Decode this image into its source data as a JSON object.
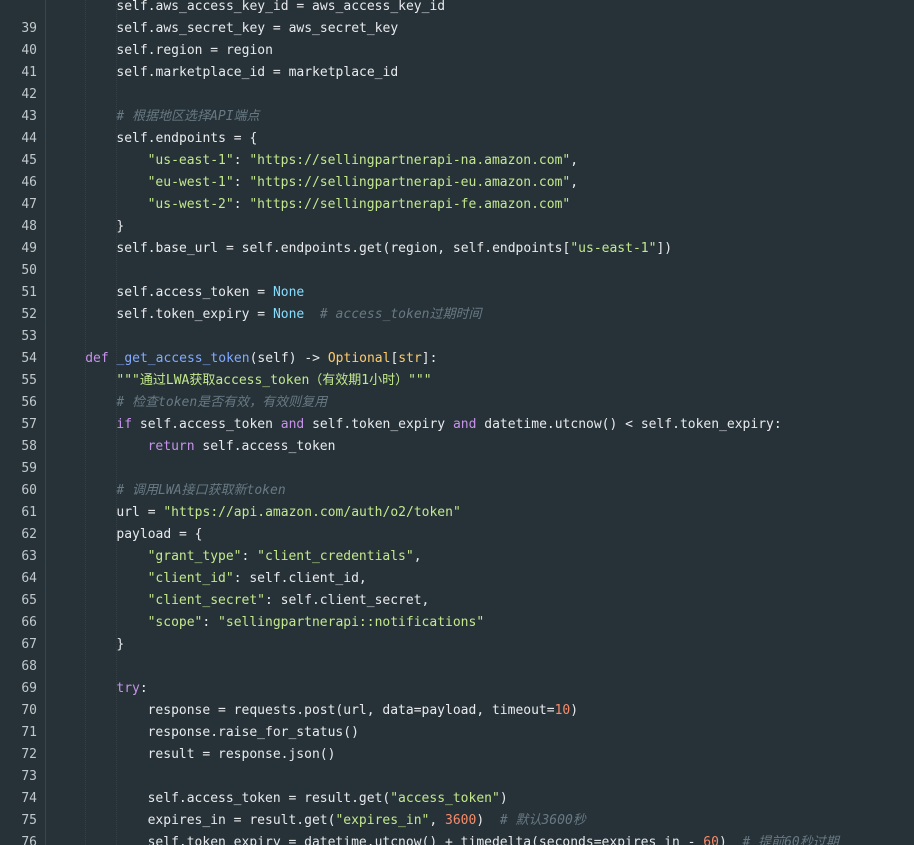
{
  "editor": {
    "language": "python",
    "colors": {
      "background": "#263238",
      "gutter_text": "#c0c8cc",
      "plain": "#e8eaed",
      "keyword": "#c792ea",
      "function": "#82aaff",
      "string": "#c3e88d",
      "comment": "#697982",
      "number": "#f78c6c",
      "constant": "#89ddff",
      "type": "#ffcb6b"
    },
    "lines": [
      {
        "n": "",
        "indent": 8,
        "tokens": [
          [
            "pl",
            "self.aws_access_key_id = aws_access_key_id"
          ]
        ]
      },
      {
        "n": "39",
        "indent": 8,
        "tokens": [
          [
            "pl",
            "self.aws_secret_key = aws_secret_key"
          ]
        ]
      },
      {
        "n": "40",
        "indent": 8,
        "tokens": [
          [
            "pl",
            "self.region = region"
          ]
        ]
      },
      {
        "n": "41",
        "indent": 8,
        "tokens": [
          [
            "pl",
            "self.marketplace_id = marketplace_id"
          ]
        ]
      },
      {
        "n": "42",
        "indent": 0,
        "tokens": []
      },
      {
        "n": "43",
        "indent": 8,
        "tokens": [
          [
            "cm",
            "# 根据地区选择API端点"
          ]
        ]
      },
      {
        "n": "44",
        "indent": 8,
        "tokens": [
          [
            "pl",
            "self.endpoints = {"
          ]
        ]
      },
      {
        "n": "45",
        "indent": 12,
        "tokens": [
          [
            "st",
            "\"us-east-1\""
          ],
          [
            "pl",
            ": "
          ],
          [
            "st",
            "\"https://sellingpartnerapi-na.amazon.com\""
          ],
          [
            "pl",
            ","
          ]
        ]
      },
      {
        "n": "46",
        "indent": 12,
        "tokens": [
          [
            "st",
            "\"eu-west-1\""
          ],
          [
            "pl",
            ": "
          ],
          [
            "st",
            "\"https://sellingpartnerapi-eu.amazon.com\""
          ],
          [
            "pl",
            ","
          ]
        ]
      },
      {
        "n": "47",
        "indent": 12,
        "tokens": [
          [
            "st",
            "\"us-west-2\""
          ],
          [
            "pl",
            ": "
          ],
          [
            "st",
            "\"https://sellingpartnerapi-fe.amazon.com\""
          ]
        ]
      },
      {
        "n": "48",
        "indent": 8,
        "tokens": [
          [
            "pl",
            "}"
          ]
        ]
      },
      {
        "n": "49",
        "indent": 8,
        "tokens": [
          [
            "pl",
            "self.base_url = self.endpoints.get(region, self.endpoints["
          ],
          [
            "st",
            "\"us-east-1\""
          ],
          [
            "pl",
            "])"
          ]
        ]
      },
      {
        "n": "50",
        "indent": 0,
        "tokens": []
      },
      {
        "n": "51",
        "indent": 8,
        "tokens": [
          [
            "pl",
            "self.access_token = "
          ],
          [
            "cn",
            "None"
          ]
        ]
      },
      {
        "n": "52",
        "indent": 8,
        "tokens": [
          [
            "pl",
            "self.token_expiry = "
          ],
          [
            "cn",
            "None"
          ],
          [
            "pl",
            "  "
          ],
          [
            "cm",
            "# access_token过期时间"
          ]
        ]
      },
      {
        "n": "53",
        "indent": 0,
        "tokens": []
      },
      {
        "n": "54",
        "indent": 4,
        "tokens": [
          [
            "kw",
            "def "
          ],
          [
            "fn",
            "_get_access_token"
          ],
          [
            "pl",
            "(self) -> "
          ],
          [
            "ty",
            "Optional"
          ],
          [
            "pl",
            "["
          ],
          [
            "ty",
            "str"
          ],
          [
            "pl",
            "]:"
          ]
        ]
      },
      {
        "n": "55",
        "indent": 8,
        "tokens": [
          [
            "st",
            "\"\"\"通过LWA获取access_token（有效期1小时）\"\"\""
          ]
        ]
      },
      {
        "n": "56",
        "indent": 8,
        "tokens": [
          [
            "cm",
            "# 检查token是否有效，有效则复用"
          ]
        ]
      },
      {
        "n": "57",
        "indent": 8,
        "tokens": [
          [
            "kw",
            "if "
          ],
          [
            "pl",
            "self.access_token "
          ],
          [
            "kw",
            "and "
          ],
          [
            "pl",
            "self.token_expiry "
          ],
          [
            "kw",
            "and "
          ],
          [
            "pl",
            "datetime.utcnow() < self.token_expiry:"
          ]
        ]
      },
      {
        "n": "58",
        "indent": 12,
        "tokens": [
          [
            "kw",
            "return "
          ],
          [
            "pl",
            "self.access_token"
          ]
        ]
      },
      {
        "n": "59",
        "indent": 0,
        "tokens": []
      },
      {
        "n": "60",
        "indent": 8,
        "tokens": [
          [
            "cm",
            "# 调用LWA接口获取新token"
          ]
        ]
      },
      {
        "n": "61",
        "indent": 8,
        "tokens": [
          [
            "pl",
            "url = "
          ],
          [
            "st",
            "\"https://api.amazon.com/auth/o2/token\""
          ]
        ]
      },
      {
        "n": "62",
        "indent": 8,
        "tokens": [
          [
            "pl",
            "payload = {"
          ]
        ]
      },
      {
        "n": "63",
        "indent": 12,
        "tokens": [
          [
            "st",
            "\"grant_type\""
          ],
          [
            "pl",
            ": "
          ],
          [
            "st",
            "\"client_credentials\""
          ],
          [
            "pl",
            ","
          ]
        ]
      },
      {
        "n": "64",
        "indent": 12,
        "tokens": [
          [
            "st",
            "\"client_id\""
          ],
          [
            "pl",
            ": self.client_id,"
          ]
        ]
      },
      {
        "n": "65",
        "indent": 12,
        "tokens": [
          [
            "st",
            "\"client_secret\""
          ],
          [
            "pl",
            ": self.client_secret,"
          ]
        ]
      },
      {
        "n": "66",
        "indent": 12,
        "tokens": [
          [
            "st",
            "\"scope\""
          ],
          [
            "pl",
            ": "
          ],
          [
            "st",
            "\"sellingpartnerapi::notifications\""
          ]
        ]
      },
      {
        "n": "67",
        "indent": 8,
        "tokens": [
          [
            "pl",
            "}"
          ]
        ]
      },
      {
        "n": "68",
        "indent": 0,
        "tokens": []
      },
      {
        "n": "69",
        "indent": 8,
        "tokens": [
          [
            "kw",
            "try"
          ],
          [
            "pl",
            ":"
          ]
        ]
      },
      {
        "n": "70",
        "indent": 12,
        "tokens": [
          [
            "pl",
            "response = requests.post(url, data=payload, timeout="
          ],
          [
            "nm",
            "10"
          ],
          [
            "pl",
            ")"
          ]
        ]
      },
      {
        "n": "71",
        "indent": 12,
        "tokens": [
          [
            "pl",
            "response.raise_for_status()"
          ]
        ]
      },
      {
        "n": "72",
        "indent": 12,
        "tokens": [
          [
            "pl",
            "result = response.json()"
          ]
        ]
      },
      {
        "n": "73",
        "indent": 0,
        "tokens": []
      },
      {
        "n": "74",
        "indent": 12,
        "tokens": [
          [
            "pl",
            "self.access_token = result.get("
          ],
          [
            "st",
            "\"access_token\""
          ],
          [
            "pl",
            ")"
          ]
        ]
      },
      {
        "n": "75",
        "indent": 12,
        "tokens": [
          [
            "pl",
            "expires_in = result.get("
          ],
          [
            "st",
            "\"expires_in\""
          ],
          [
            "pl",
            ", "
          ],
          [
            "nm",
            "3600"
          ],
          [
            "pl",
            ")  "
          ],
          [
            "cm",
            "# 默认3600秒"
          ]
        ]
      },
      {
        "n": "76",
        "indent": 12,
        "tokens": [
          [
            "pl",
            "self.token_expiry = datetime.utcnow() + timedelta(seconds=expires_in - "
          ],
          [
            "nm",
            "60"
          ],
          [
            "pl",
            ")  "
          ],
          [
            "cm",
            "# 提前60秒过期"
          ]
        ]
      }
    ]
  }
}
